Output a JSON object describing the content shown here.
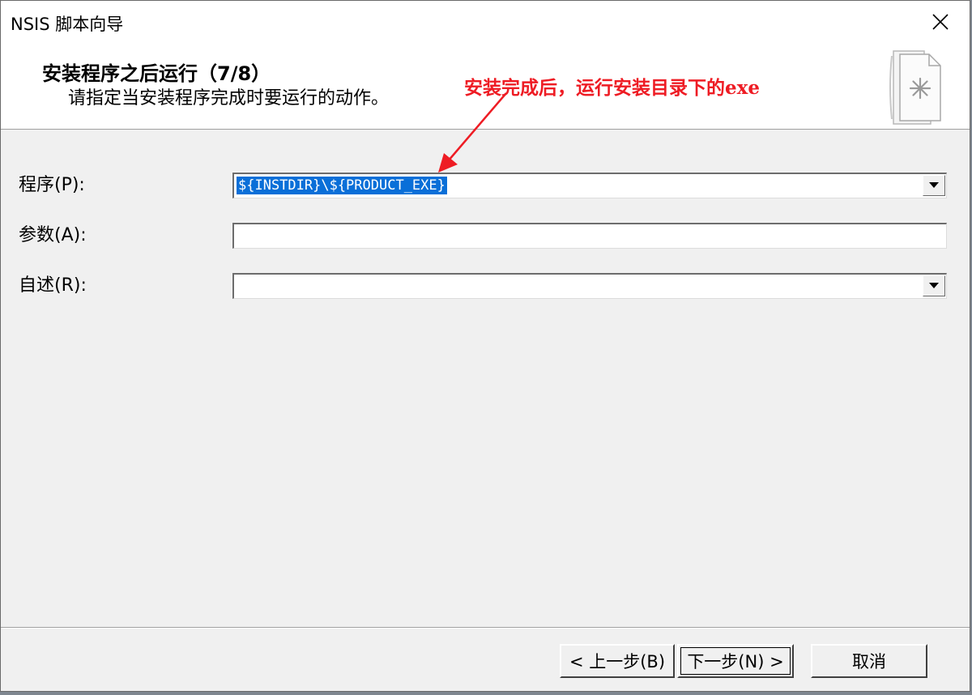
{
  "window": {
    "title": "NSIS 脚本向导"
  },
  "header": {
    "title": "安装程序之后运行（7/8）",
    "subtitle": "请指定当安装程序完成时要运行的动作。"
  },
  "annotation": {
    "text": "安装完成后，运行安装目录下的exe",
    "color": "#ee1c24"
  },
  "form": {
    "program": {
      "label": "程序(P):",
      "value": "${INSTDIR}\\${PRODUCT_EXE}"
    },
    "params": {
      "label": "参数(A):",
      "value": ""
    },
    "description": {
      "label": "自述(R):",
      "value": ""
    }
  },
  "buttons": {
    "back": "< 上一步(B)",
    "next": "下一步(N) >",
    "cancel": "取消"
  },
  "icons": {
    "close": "close-icon",
    "wizard": "document-wizard-icon",
    "dropdown": "chevron-down-icon"
  }
}
